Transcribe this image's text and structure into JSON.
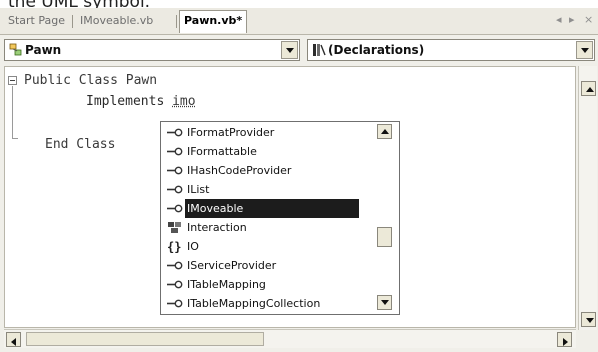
{
  "caption": {
    "text": "the UML symbol."
  },
  "tabs": [
    {
      "label": "Start Page"
    },
    {
      "label": "IMoveable.vb"
    },
    {
      "label": "Pawn.vb*"
    }
  ],
  "tab_nav": {
    "prev": "◂",
    "next": "▸",
    "close": "×"
  },
  "class_combo": {
    "value": "Pawn",
    "icon": "class-icon"
  },
  "member_combo": {
    "value": "(Declarations)",
    "icon": "declarations-icon"
  },
  "code": {
    "line1": "Public Class Pawn",
    "line2_keyword": "Implements",
    "line2_typed": "imo",
    "line3": "End Class"
  },
  "intellisense": {
    "items": [
      {
        "label": "IFormatProvider",
        "icon": "interface-icon"
      },
      {
        "label": "IFormattable",
        "icon": "interface-icon"
      },
      {
        "label": "IHashCodeProvider",
        "icon": "interface-icon"
      },
      {
        "label": "IList",
        "icon": "interface-icon"
      },
      {
        "label": "IMoveable",
        "icon": "interface-icon",
        "selected": true
      },
      {
        "label": "Interaction",
        "icon": "module-icon"
      },
      {
        "label": "IO",
        "icon": "namespace-icon"
      },
      {
        "label": "IServiceProvider",
        "icon": "interface-icon"
      },
      {
        "label": "ITableMapping",
        "icon": "interface-icon"
      },
      {
        "label": "ITableMappingCollection",
        "icon": "interface-icon"
      }
    ]
  },
  "colors": {
    "selection": "#1c1c1c",
    "chrome": "#ece9d8"
  }
}
